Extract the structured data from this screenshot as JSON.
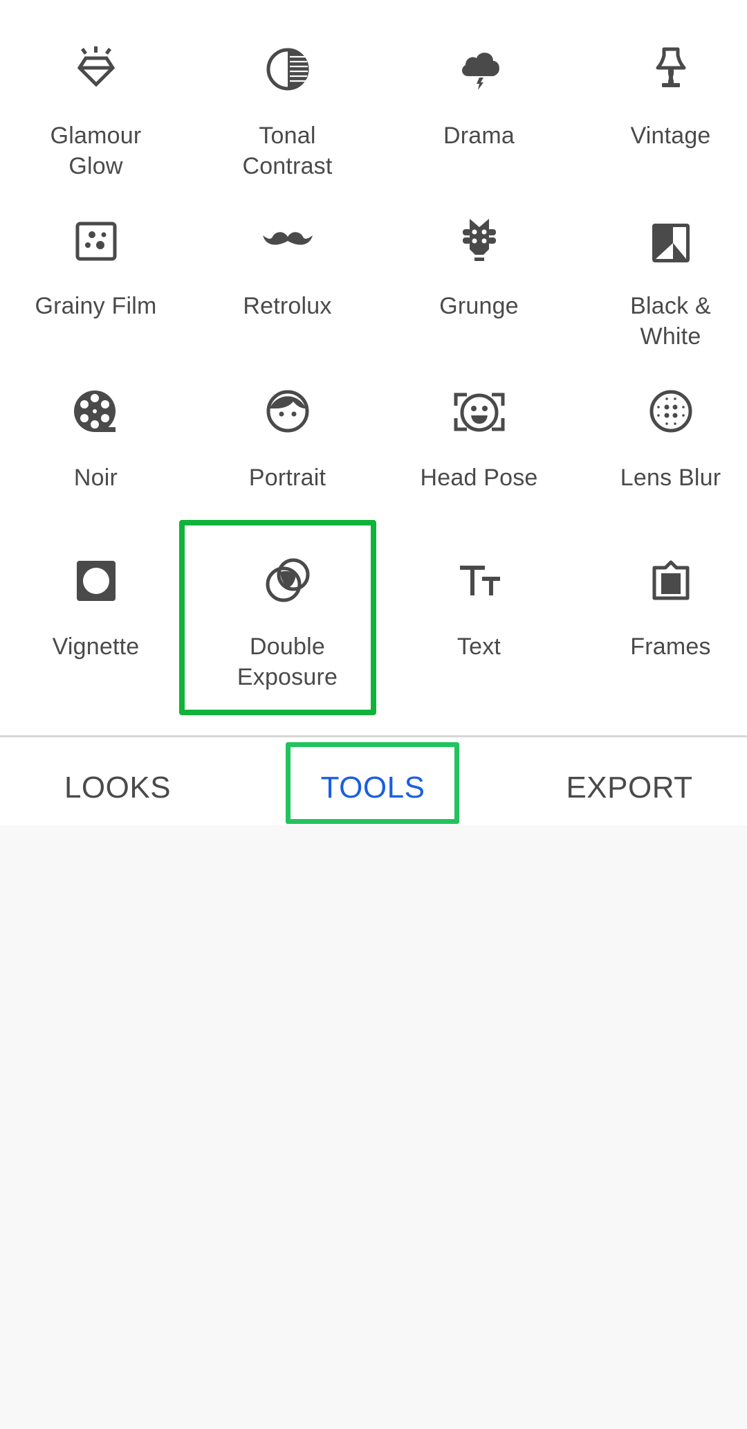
{
  "tools": [
    {
      "label": "Glamour\nGlow",
      "icon": "diamond-sparkle-icon"
    },
    {
      "label": "Tonal\nContrast",
      "icon": "tonal-contrast-icon"
    },
    {
      "label": "Drama",
      "icon": "storm-cloud-icon"
    },
    {
      "label": "Vintage",
      "icon": "lamp-icon"
    },
    {
      "label": "Grainy Film",
      "icon": "grain-icon"
    },
    {
      "label": "Retrolux",
      "icon": "mustache-icon"
    },
    {
      "label": "Grunge",
      "icon": "guitar-head-icon"
    },
    {
      "label": "Black &\nWhite",
      "icon": "black-white-icon"
    },
    {
      "label": "Noir",
      "icon": "film-reel-icon"
    },
    {
      "label": "Portrait",
      "icon": "face-icon"
    },
    {
      "label": "Head Pose",
      "icon": "face-frame-icon"
    },
    {
      "label": "Lens Blur",
      "icon": "lens-blur-icon"
    },
    {
      "label": "Vignette",
      "icon": "vignette-icon"
    },
    {
      "label": "Double\nExposure",
      "icon": "double-exposure-icon"
    },
    {
      "label": "Text",
      "icon": "text-icon"
    },
    {
      "label": "Frames",
      "icon": "frame-icon"
    }
  ],
  "highlighted_tool": "Double Exposure",
  "tabs": [
    {
      "label": "LOOKS",
      "active": false
    },
    {
      "label": "TOOLS",
      "active": true
    },
    {
      "label": "EXPORT",
      "active": false
    }
  ],
  "colors": {
    "icon": "#4a4a4a",
    "text": "#4a4a4a",
    "active_tab": "#1a5fe0",
    "highlight": "#0fb33a",
    "tab_highlight": "#22c35e",
    "background": "#f8f8f8"
  }
}
